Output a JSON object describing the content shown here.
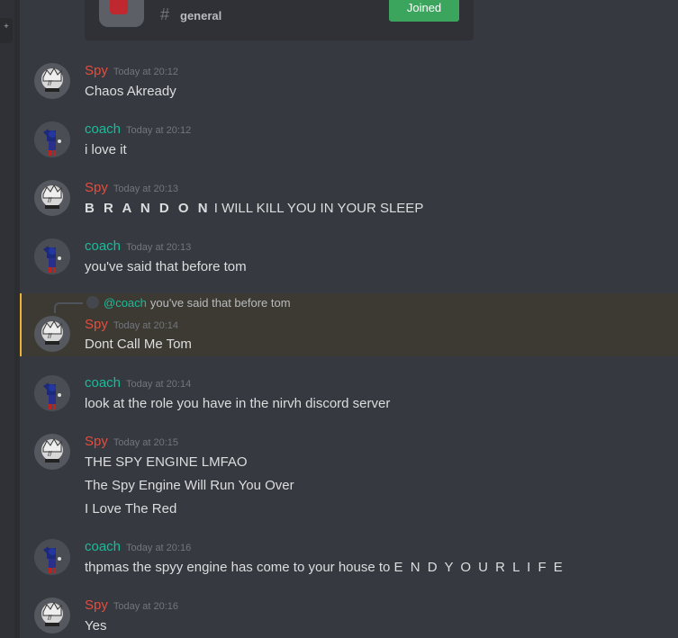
{
  "rail": {
    "plus_glyph": "+"
  },
  "invite": {
    "hash_glyph": "#",
    "channel": "general",
    "button_label": "Joined"
  },
  "messages": [
    {
      "author": "Spy",
      "role": "spy",
      "timestamp": "Today at 20:12",
      "lines": [
        "Chaos Akready"
      ]
    },
    {
      "author": "coach",
      "role": "coach",
      "timestamp": "Today at 20:12",
      "lines": [
        "i love it"
      ]
    },
    {
      "author": "Spy",
      "role": "spy",
      "timestamp": "Today at 20:13",
      "bold_prefix": "B R A N D O N",
      "lines": [
        " I WILL KILL YOU IN YOUR SLEEP"
      ]
    },
    {
      "author": "coach",
      "role": "coach",
      "timestamp": "Today at 20:13",
      "lines": [
        "you've said that before tom"
      ]
    },
    {
      "author": "Spy",
      "role": "spy",
      "timestamp": "Today at 20:14",
      "lines": [
        "Dont Call Me Tom"
      ],
      "reply": {
        "mention": "@coach",
        "text": "you've said that before tom"
      }
    },
    {
      "author": "coach",
      "role": "coach",
      "timestamp": "Today at 20:14",
      "lines": [
        "look at the role you have in the nirvh discord server"
      ]
    },
    {
      "author": "Spy",
      "role": "spy",
      "timestamp": "Today at 20:15",
      "lines": [
        "THE SPY ENGINE LMFAO",
        "The Spy Engine Will Run You Over",
        "I Love The Red"
      ]
    },
    {
      "author": "coach",
      "role": "coach",
      "timestamp": "Today at 20:16",
      "lines": [
        "thpmas the spyy engine has come to your house to "
      ],
      "spaced_suffix": "E N D Y O U R L I F E"
    },
    {
      "author": "Spy",
      "role": "spy",
      "timestamp": "Today at 20:16",
      "lines": [
        "Yes"
      ]
    }
  ],
  "colors": {
    "background": "#36393f",
    "spy_name": "#e74c3c",
    "coach_name": "#1abc9c",
    "joined_button": "#3ba55d",
    "reply_highlight_border": "#f0b232"
  }
}
